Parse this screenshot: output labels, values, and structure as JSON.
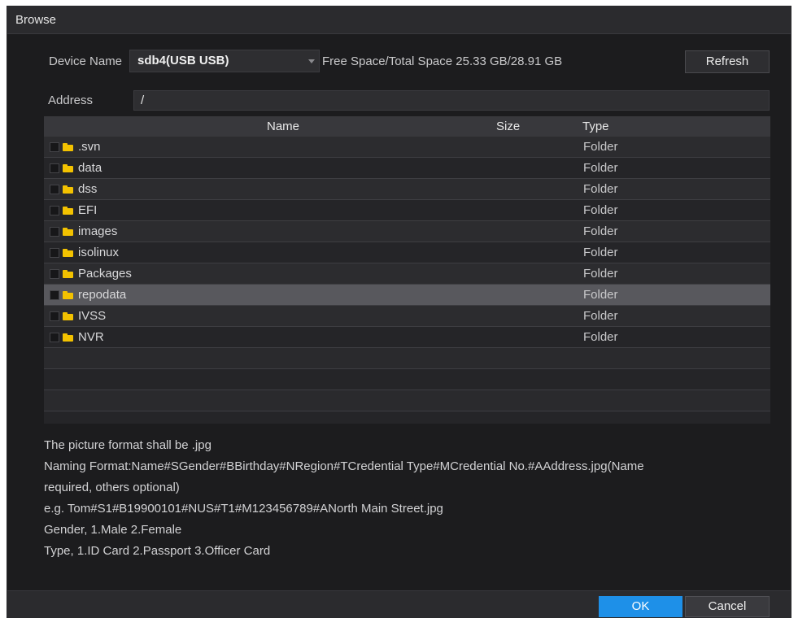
{
  "dialog": {
    "title": "Browse"
  },
  "device": {
    "label": "Device Name",
    "value": "sdb4(USB USB)",
    "space_text": "Free Space/Total Space 25.33 GB/28.91 GB",
    "refresh_label": "Refresh"
  },
  "address": {
    "label": "Address",
    "value": "/"
  },
  "table": {
    "headers": {
      "name": "Name",
      "size": "Size",
      "type": "Type"
    },
    "rows": [
      {
        "name": ".svn",
        "size": "",
        "type": "Folder"
      },
      {
        "name": "data",
        "size": "",
        "type": "Folder"
      },
      {
        "name": "dss",
        "size": "",
        "type": "Folder"
      },
      {
        "name": "EFI",
        "size": "",
        "type": "Folder"
      },
      {
        "name": "images",
        "size": "",
        "type": "Folder"
      },
      {
        "name": "isolinux",
        "size": "",
        "type": "Folder"
      },
      {
        "name": "Packages",
        "size": "",
        "type": "Folder"
      },
      {
        "name": "repodata",
        "size": "",
        "type": "Folder"
      },
      {
        "name": "IVSS",
        "size": "",
        "type": "Folder"
      },
      {
        "name": "NVR",
        "size": "",
        "type": "Folder"
      }
    ],
    "selected_row": 7,
    "row_icon": "folder-icon"
  },
  "notes": [
    "The picture format shall be .jpg",
    " Naming Format:Name#SGender#BBirthday#NRegion#TCredential Type#MCredential No.#AAddress.jpg(Name",
    "required, others optional)",
    "e.g. Tom#S1#B19900101#NUS#T1#M123456789#ANorth Main Street.jpg",
    "Gender, 1.Male 2.Female",
    "Type, 1.ID Card 2.Passport 3.Officer Card"
  ],
  "footer": {
    "ok_label": "OK",
    "cancel_label": "Cancel"
  },
  "colors": {
    "dialog_bg": "#1c1c1e",
    "accent": "#1e90e8",
    "folder": "#f3c200",
    "selected_row": "#58585d"
  }
}
